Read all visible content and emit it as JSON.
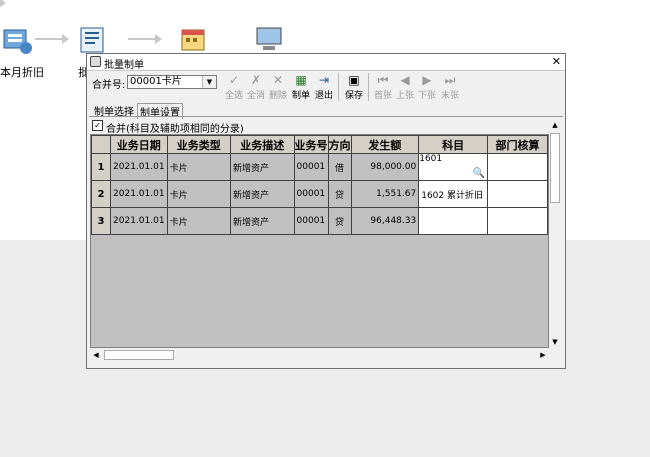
{
  "desktop": {
    "item1_label": "本月折旧",
    "item2_label": "批"
  },
  "dialog": {
    "title": "批量制单",
    "close": "✕",
    "merge_label": "合并号:",
    "merge_value": "00001卡片",
    "toolbar": [
      {
        "icon": "✓",
        "label": "全选",
        "enabled": false
      },
      {
        "icon": "✗",
        "label": "全消",
        "enabled": false
      },
      {
        "icon": "✕",
        "label": "删除",
        "enabled": false
      },
      {
        "icon": "▦",
        "label": "制单",
        "enabled": true
      },
      {
        "icon": "⇥",
        "label": "退出",
        "enabled": true
      },
      {
        "icon": "▣",
        "label": "保存",
        "enabled": true
      },
      {
        "icon": "⏮",
        "label": "首张",
        "enabled": false
      },
      {
        "icon": "◀",
        "label": "上张",
        "enabled": false
      },
      {
        "icon": "▶",
        "label": "下张",
        "enabled": false
      },
      {
        "icon": "⏭",
        "label": "末张",
        "enabled": false
      }
    ],
    "tabs": [
      "制单选择",
      "制单设置"
    ],
    "merge_checkbox": "合并(科目及辅助项相同的分录)",
    "columns": [
      "业务日期",
      "业务类型",
      "业务描述",
      "业务号",
      "方向",
      "发生额",
      "科目",
      "部门核算"
    ],
    "rows": [
      {
        "no": "1",
        "date": "2021.01.01",
        "type": "卡片",
        "desc": "新增资产",
        "code": "00001",
        "dir": "借",
        "amount": "98,000.00",
        "subject": "1601",
        "dept": ""
      },
      {
        "no": "2",
        "date": "2021.01.01",
        "type": "卡片",
        "desc": "新增资产",
        "code": "00001",
        "dir": "贷",
        "amount": "1,551.67",
        "subject": "1602  累计折旧",
        "dept": ""
      },
      {
        "no": "3",
        "date": "2021.01.01",
        "type": "卡片",
        "desc": "新增资产",
        "code": "00001",
        "dir": "贷",
        "amount": "96,448.33",
        "subject": "",
        "dept": ""
      }
    ]
  }
}
